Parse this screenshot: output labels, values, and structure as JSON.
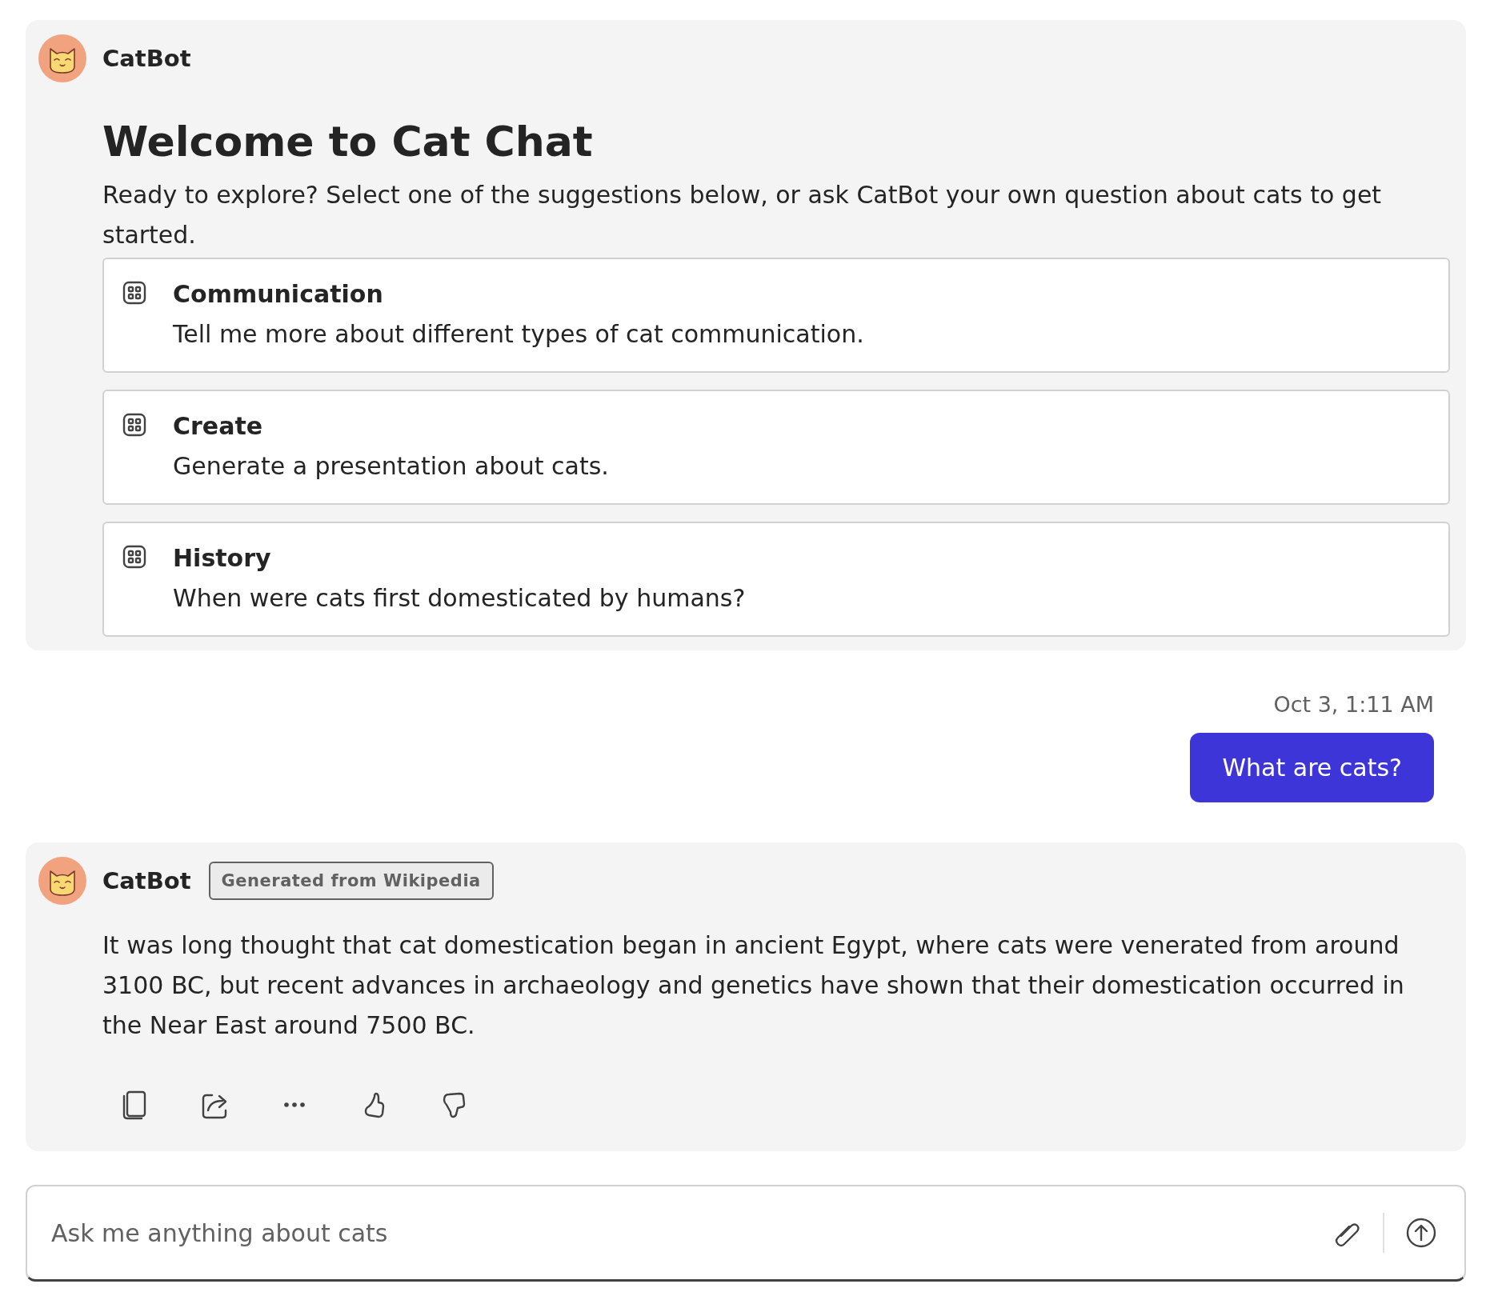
{
  "messages": [
    {
      "kind": "welcome",
      "sender": "CatBot",
      "title": "Welcome to Cat Chat",
      "text": "Ready to explore? Select one of the suggestions below, or ask CatBot your own question about cats to get started.",
      "suggestions": [
        {
          "title": "Communication",
          "text": "Tell me more about different types of cat communication."
        },
        {
          "title": "Create",
          "text": "Generate a presentation about cats."
        },
        {
          "title": "History",
          "text": "When were cats first domesticated by humans?"
        }
      ]
    },
    {
      "kind": "user",
      "timestamp": "Oct 3, 1:11 AM",
      "text": "What are cats?"
    },
    {
      "kind": "bot",
      "sender": "CatBot",
      "badge": "Generated from Wikipedia",
      "text": "It was long thought that cat domestication began in ancient Egypt, where cats were venerated from around 3100 BC, but recent advances in archaeology and genetics have shown that their domestication occurred in the Near East around 7500 BC."
    }
  ],
  "composer": {
    "placeholder": "Ask me anything about cats"
  }
}
